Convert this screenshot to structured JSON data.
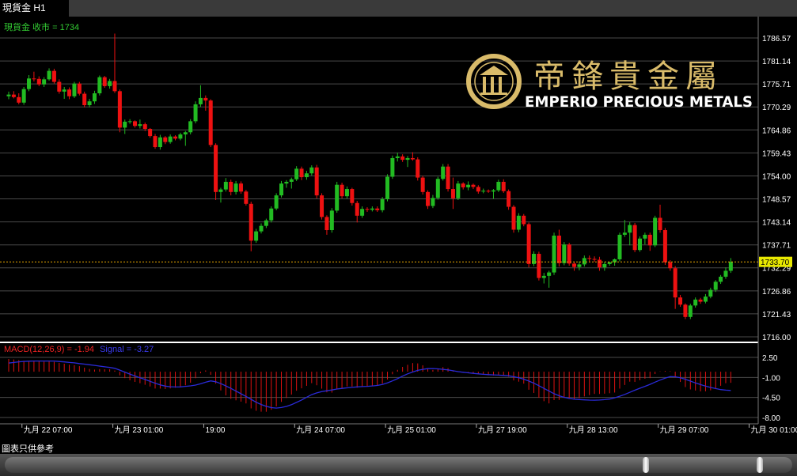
{
  "tab": {
    "title": "現貨金 H1"
  },
  "price_label": "現貨金 收市 = 1734",
  "macd_label": {
    "main": "MACD(12,26,9) = -1.94",
    "signal": "Signal = -3.27"
  },
  "logo": {
    "chinese": "帝鋒貴金屬",
    "english": "EMPERIO PRECIOUS METALS"
  },
  "footer_note": "圖表只供參考",
  "colors": {
    "bull": "#22bb22",
    "bear": "#ee1111",
    "signal": "#2a2ad8",
    "histogram": "#dd1111",
    "current_price": "#e8e800",
    "logo_gold": "#d9bb6a",
    "price_label": "#33cc33"
  },
  "chart_data": {
    "type": "candlestick",
    "symbol": "現貨金",
    "timeframe": "H1",
    "current_price": 1733.7,
    "current_price_label": "1733.70",
    "price_axis": {
      "ylim": [
        1716.0,
        1786.57
      ],
      "ticks": [
        "1786.57",
        "1781.14",
        "1775.71",
        "1770.29",
        "1764.86",
        "1759.43",
        "1754.00",
        "1748.57",
        "1743.14",
        "1737.71",
        "1732.29",
        "1726.86",
        "1721.43",
        "1716.00"
      ]
    },
    "macd_axis": {
      "ylim": [
        -8.0,
        2.5
      ],
      "ticks": [
        "2.50",
        "-1.00",
        "-4.50",
        "-8.00"
      ]
    },
    "x_ticks": [
      {
        "label": "九月 22 07:00",
        "index": 2
      },
      {
        "label": "九月 23 01:00",
        "index": 20
      },
      {
        "label": "19:00",
        "index": 38
      },
      {
        "label": "九月 24 07:00",
        "index": 56
      },
      {
        "label": "九月 25 01:00",
        "index": 74
      },
      {
        "label": "九月 27 19:00",
        "index": 92
      },
      {
        "label": "九月 28 13:00",
        "index": 110
      },
      {
        "label": "九月 29 07:00",
        "index": 128
      },
      {
        "label": "九月 30 01:00",
        "index": 146
      }
    ],
    "candles": [
      [
        1772.8,
        1773.9,
        1772.1,
        1773.2
      ],
      [
        1773.2,
        1774.0,
        1772.3,
        1772.6
      ],
      [
        1772.6,
        1773.5,
        1770.9,
        1771.3
      ],
      [
        1771.3,
        1775.0,
        1770.8,
        1774.5
      ],
      [
        1774.5,
        1777.8,
        1774.0,
        1777.0
      ],
      [
        1777.0,
        1778.6,
        1776.3,
        1776.9
      ],
      [
        1776.9,
        1777.5,
        1775.2,
        1775.6
      ],
      [
        1775.6,
        1777.3,
        1775.0,
        1776.8
      ],
      [
        1776.8,
        1779.4,
        1776.5,
        1778.8
      ],
      [
        1778.8,
        1779.3,
        1775.8,
        1776.2
      ],
      [
        1776.2,
        1776.8,
        1773.4,
        1773.9
      ],
      [
        1773.9,
        1775.0,
        1772.2,
        1774.4
      ],
      [
        1774.4,
        1774.9,
        1772.1,
        1772.8
      ],
      [
        1772.8,
        1776.2,
        1772.4,
        1775.8
      ],
      [
        1775.8,
        1776.2,
        1773.0,
        1773.4
      ],
      [
        1773.4,
        1773.9,
        1770.2,
        1770.7
      ],
      [
        1770.7,
        1772.2,
        1770.2,
        1771.6
      ],
      [
        1771.6,
        1774.1,
        1771.0,
        1773.5
      ],
      [
        1773.5,
        1777.7,
        1773.0,
        1777.3
      ],
      [
        1777.3,
        1777.6,
        1774.8,
        1775.2
      ],
      [
        1775.2,
        1776.9,
        1774.6,
        1776.4
      ],
      [
        1776.4,
        1787.6,
        1773.6,
        1774.0
      ],
      [
        1774.0,
        1774.4,
        1764.3,
        1765.4
      ],
      [
        1765.4,
        1767.3,
        1763.9,
        1766.8
      ],
      [
        1766.8,
        1767.4,
        1766.3,
        1766.9
      ],
      [
        1766.9,
        1767.1,
        1765.4,
        1765.8
      ],
      [
        1765.8,
        1767.3,
        1765.2,
        1766.2
      ],
      [
        1766.2,
        1766.6,
        1764.6,
        1765.1
      ],
      [
        1765.1,
        1765.3,
        1763.0,
        1763.4
      ],
      [
        1763.4,
        1763.9,
        1760.4,
        1760.8
      ],
      [
        1760.8,
        1763.7,
        1760.2,
        1763.1
      ],
      [
        1763.1,
        1763.4,
        1761.5,
        1762.0
      ],
      [
        1762.0,
        1763.8,
        1761.6,
        1763.3
      ],
      [
        1763.3,
        1763.6,
        1762.4,
        1762.8
      ],
      [
        1762.8,
        1764.2,
        1762.4,
        1763.8
      ],
      [
        1763.8,
        1764.6,
        1761.1,
        1764.3
      ],
      [
        1764.3,
        1767.4,
        1763.8,
        1766.9
      ],
      [
        1766.9,
        1771.6,
        1766.4,
        1770.9
      ],
      [
        1770.9,
        1775.4,
        1770.3,
        1772.4
      ],
      [
        1772.4,
        1773.0,
        1769.4,
        1771.8
      ],
      [
        1771.8,
        1772.1,
        1760.8,
        1761.3
      ],
      [
        1761.3,
        1761.7,
        1748.3,
        1750.2
      ],
      [
        1750.2,
        1751.2,
        1747.7,
        1750.8
      ],
      [
        1750.8,
        1753.5,
        1750.3,
        1752.6
      ],
      [
        1752.6,
        1753.1,
        1749.4,
        1750.2
      ],
      [
        1750.2,
        1752.8,
        1749.6,
        1752.2
      ],
      [
        1752.2,
        1752.7,
        1749.8,
        1750.3
      ],
      [
        1750.3,
        1750.7,
        1747.0,
        1747.4
      ],
      [
        1747.4,
        1747.9,
        1736.2,
        1738.7
      ],
      [
        1738.7,
        1741.5,
        1738.2,
        1740.9
      ],
      [
        1740.9,
        1742.8,
        1740.4,
        1742.2
      ],
      [
        1742.2,
        1743.9,
        1741.7,
        1743.5
      ],
      [
        1743.5,
        1746.8,
        1743.0,
        1746.3
      ],
      [
        1746.3,
        1749.9,
        1745.9,
        1749.4
      ],
      [
        1749.4,
        1752.8,
        1748.9,
        1752.2
      ],
      [
        1752.2,
        1753.0,
        1751.2,
        1752.6
      ],
      [
        1752.6,
        1753.6,
        1751.0,
        1753.2
      ],
      [
        1753.2,
        1756.3,
        1752.8,
        1755.7
      ],
      [
        1755.7,
        1756.2,
        1753.0,
        1753.7
      ],
      [
        1753.7,
        1755.2,
        1753.1,
        1754.6
      ],
      [
        1754.6,
        1756.5,
        1754.1,
        1756.0
      ],
      [
        1756.0,
        1756.6,
        1748.7,
        1749.4
      ],
      [
        1749.4,
        1749.9,
        1743.7,
        1744.3
      ],
      [
        1744.3,
        1744.7,
        1740.1,
        1741.2
      ],
      [
        1741.2,
        1746.4,
        1740.6,
        1745.8
      ],
      [
        1745.8,
        1752.6,
        1745.3,
        1751.9
      ],
      [
        1751.9,
        1752.4,
        1748.7,
        1749.2
      ],
      [
        1749.2,
        1751.5,
        1748.7,
        1750.9
      ],
      [
        1750.9,
        1751.2,
        1747.0,
        1747.6
      ],
      [
        1747.6,
        1748.1,
        1743.0,
        1744.6
      ],
      [
        1744.6,
        1746.8,
        1744.1,
        1746.2
      ],
      [
        1746.2,
        1746.6,
        1745.5,
        1746.0
      ],
      [
        1746.0,
        1746.8,
        1745.6,
        1746.3
      ],
      [
        1746.3,
        1746.8,
        1745.5,
        1745.9
      ],
      [
        1745.9,
        1749.0,
        1745.4,
        1748.5
      ],
      [
        1748.5,
        1754.4,
        1748.0,
        1753.8
      ],
      [
        1753.8,
        1758.8,
        1753.3,
        1758.2
      ],
      [
        1758.2,
        1759.5,
        1757.4,
        1758.6
      ],
      [
        1758.6,
        1759.1,
        1757.3,
        1757.8
      ],
      [
        1757.8,
        1758.7,
        1756.1,
        1758.2
      ],
      [
        1758.2,
        1759.6,
        1757.6,
        1757.9
      ],
      [
        1757.9,
        1758.4,
        1752.9,
        1753.6
      ],
      [
        1753.6,
        1754.0,
        1749.6,
        1750.2
      ],
      [
        1750.2,
        1750.6,
        1746.2,
        1746.9
      ],
      [
        1746.9,
        1749.5,
        1746.4,
        1748.8
      ],
      [
        1748.8,
        1753.8,
        1748.4,
        1753.3
      ],
      [
        1753.3,
        1756.8,
        1752.9,
        1756.2
      ],
      [
        1756.2,
        1756.8,
        1750.3,
        1750.9
      ],
      [
        1750.9,
        1753.6,
        1746.2,
        1748.7
      ],
      [
        1748.7,
        1752.8,
        1748.3,
        1752.2
      ],
      [
        1752.2,
        1752.5,
        1750.8,
        1751.3
      ],
      [
        1751.3,
        1752.7,
        1750.6,
        1751.9
      ],
      [
        1751.9,
        1752.2,
        1750.9,
        1751.4
      ],
      [
        1751.4,
        1751.8,
        1749.8,
        1750.3
      ],
      [
        1750.3,
        1751.0,
        1749.9,
        1750.5
      ],
      [
        1750.5,
        1750.8,
        1750.0,
        1750.3
      ],
      [
        1750.3,
        1750.9,
        1748.6,
        1750.6
      ],
      [
        1750.6,
        1753.1,
        1750.2,
        1752.6
      ],
      [
        1752.6,
        1753.2,
        1750.0,
        1750.4
      ],
      [
        1750.4,
        1750.8,
        1746.0,
        1746.7
      ],
      [
        1746.7,
        1747.1,
        1740.6,
        1741.3
      ],
      [
        1741.3,
        1745.2,
        1740.7,
        1744.6
      ],
      [
        1744.6,
        1745.0,
        1742.1,
        1742.6
      ],
      [
        1742.6,
        1743.0,
        1732.4,
        1733.2
      ],
      [
        1733.2,
        1736.2,
        1732.7,
        1735.6
      ],
      [
        1735.6,
        1736.1,
        1729.3,
        1729.9
      ],
      [
        1729.9,
        1731.1,
        1728.6,
        1730.4
      ],
      [
        1730.4,
        1731.6,
        1727.6,
        1731.2
      ],
      [
        1731.2,
        1740.6,
        1730.6,
        1739.9
      ],
      [
        1739.9,
        1741.3,
        1732.6,
        1733.4
      ],
      [
        1733.4,
        1738.4,
        1732.9,
        1737.8
      ],
      [
        1737.8,
        1738.2,
        1732.8,
        1733.3
      ],
      [
        1733.3,
        1733.8,
        1731.6,
        1732.5
      ],
      [
        1732.5,
        1733.8,
        1731.7,
        1733.1
      ],
      [
        1733.1,
        1735.2,
        1732.6,
        1734.6
      ],
      [
        1734.6,
        1735.2,
        1733.8,
        1734.4
      ],
      [
        1734.4,
        1735.0,
        1733.7,
        1734.2
      ],
      [
        1734.2,
        1734.9,
        1731.6,
        1732.4
      ],
      [
        1732.4,
        1733.7,
        1731.6,
        1733.2
      ],
      [
        1733.2,
        1733.7,
        1732.8,
        1733.6
      ],
      [
        1733.6,
        1734.5,
        1732.8,
        1734.3
      ],
      [
        1734.3,
        1740.6,
        1733.8,
        1740.1
      ],
      [
        1740.1,
        1743.6,
        1739.6,
        1740.6
      ],
      [
        1740.6,
        1743.1,
        1737.6,
        1742.4
      ],
      [
        1742.4,
        1742.9,
        1736.0,
        1736.5
      ],
      [
        1736.5,
        1739.7,
        1736.1,
        1739.2
      ],
      [
        1739.2,
        1740.6,
        1737.8,
        1740.1
      ],
      [
        1740.1,
        1740.6,
        1736.3,
        1737.6
      ],
      [
        1737.6,
        1744.6,
        1737.2,
        1744.1
      ],
      [
        1744.1,
        1747.2,
        1740.6,
        1741.2
      ],
      [
        1741.2,
        1741.7,
        1733.0,
        1733.6
      ],
      [
        1733.6,
        1734.1,
        1731.6,
        1732.2
      ],
      [
        1732.2,
        1732.7,
        1722.6,
        1725.3
      ],
      [
        1725.3,
        1725.9,
        1723.1,
        1723.6
      ],
      [
        1723.6,
        1723.9,
        1720.2,
        1720.7
      ],
      [
        1720.7,
        1723.8,
        1720.2,
        1723.4
      ],
      [
        1723.4,
        1725.3,
        1722.9,
        1724.8
      ],
      [
        1724.8,
        1725.2,
        1723.8,
        1724.3
      ],
      [
        1724.3,
        1726.1,
        1723.9,
        1725.5
      ],
      [
        1725.5,
        1727.6,
        1725.1,
        1727.1
      ],
      [
        1727.1,
        1729.4,
        1726.6,
        1729.0
      ],
      [
        1729.0,
        1730.6,
        1728.5,
        1730.2
      ],
      [
        1730.2,
        1732.4,
        1729.7,
        1731.6
      ],
      [
        1731.6,
        1734.6,
        1731.1,
        1733.7
      ]
    ],
    "macd_histogram": [
      2.22,
      2.14,
      2.02,
      1.91,
      1.88,
      1.86,
      1.8,
      1.76,
      1.8,
      1.73,
      1.55,
      1.4,
      1.22,
      1.14,
      0.97,
      0.7,
      0.48,
      0.37,
      0.45,
      0.42,
      0.42,
      0.2,
      -0.64,
      -1.12,
      -1.5,
      -1.78,
      -2.01,
      -2.28,
      -2.58,
      -2.94,
      -2.95,
      -3.02,
      -2.92,
      -2.8,
      -2.59,
      -2.37,
      -1.92,
      -1.14,
      -0.27,
      0.22,
      -0.54,
      -2.08,
      -3.27,
      -4.14,
      -4.73,
      -5.0,
      -5.23,
      -5.54,
      -6.41,
      -6.83,
      -6.98,
      -6.99,
      -6.65,
      -6.07,
      -5.27,
      -4.6,
      -4.0,
      -3.32,
      -2.9,
      -2.47,
      -2.0,
      -2.37,
      -2.96,
      -3.6,
      -3.65,
      -3.09,
      -2.86,
      -2.57,
      -2.59,
      -2.8,
      -2.69,
      -2.62,
      -2.5,
      -2.41,
      -2.07,
      -1.37,
      -0.44,
      0.32,
      0.84,
      1.21,
      1.51,
      1.45,
      1.11,
      0.6,
      0.31,
      0.47,
      0.8,
      0.62,
      0.17,
      0.1,
      -0.05,
      -0.09,
      -0.21,
      -0.39,
      -0.54,
      -0.63,
      -0.68,
      -0.53,
      -0.59,
      -0.87,
      -1.52,
      -1.74,
      -2.09,
      -3.15,
      -3.71,
      -4.55,
      -5.15,
      -5.54,
      -4.96,
      -4.94,
      -4.6,
      -4.66,
      -4.72,
      -4.62,
      -4.32,
      -4.09,
      -3.88,
      -3.89,
      -3.84,
      -3.76,
      -3.64,
      -2.95,
      -2.32,
      -1.74,
      -1.79,
      -1.49,
      -1.23,
      -1.12,
      -0.4,
      0.06,
      0.14,
      0.09,
      -1.02,
      -1.79,
      -2.68,
      -3.09,
      -3.29,
      -3.44,
      -3.43,
      -3.25,
      -2.9,
      -2.46,
      -2.01,
      -1.94
    ],
    "macd_signal": [
      1.5,
      1.62,
      1.72,
      1.79,
      1.84,
      1.87,
      1.87,
      1.87,
      1.87,
      1.86,
      1.78,
      1.71,
      1.61,
      1.54,
      1.42,
      1.32,
      1.22,
      1.1,
      0.98,
      0.86,
      0.74,
      0.6,
      0.28,
      -0.07,
      -0.41,
      -0.74,
      -1.06,
      -1.36,
      -1.69,
      -2.01,
      -2.3,
      -2.51,
      -2.62,
      -2.67,
      -2.66,
      -2.56,
      -2.47,
      -2.33,
      -2.11,
      -1.84,
      -1.6,
      -1.75,
      -2.08,
      -2.47,
      -2.92,
      -3.39,
      -3.85,
      -4.32,
      -4.82,
      -5.33,
      -5.73,
      -6.05,
      -6.27,
      -6.35,
      -6.26,
      -6.06,
      -5.76,
      -5.36,
      -4.94,
      -4.47,
      -4.01,
      -3.7,
      -3.47,
      -3.33,
      -3.19,
      -3.03,
      -2.92,
      -2.82,
      -2.73,
      -2.66,
      -2.6,
      -2.55,
      -2.49,
      -2.4,
      -2.22,
      -1.95,
      -1.6,
      -1.21,
      -0.78,
      -0.37,
      -0.05,
      0.23,
      0.41,
      0.54,
      0.55,
      0.5,
      0.42,
      0.32,
      0.16,
      0.02,
      -0.1,
      -0.2,
      -0.29,
      -0.37,
      -0.45,
      -0.51,
      -0.56,
      -0.6,
      -0.65,
      -0.71,
      -0.87,
      -1.07,
      -1.3,
      -1.63,
      -2.0,
      -2.44,
      -2.91,
      -3.38,
      -3.84,
      -4.2,
      -4.48,
      -4.67,
      -4.79,
      -4.87,
      -4.92,
      -4.96,
      -4.97,
      -4.95,
      -4.88,
      -4.78,
      -4.56,
      -4.29,
      -3.97,
      -3.61,
      -3.23,
      -2.89,
      -2.55,
      -2.21,
      -1.83,
      -1.46,
      -1.13,
      -0.86,
      -0.89,
      -1.05,
      -1.31,
      -1.64,
      -1.96,
      -2.25,
      -2.52,
      -2.75,
      -2.95,
      -3.12,
      -3.22,
      -3.27
    ]
  }
}
